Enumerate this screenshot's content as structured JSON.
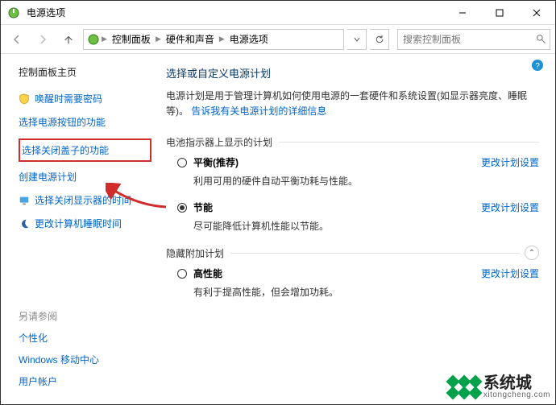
{
  "window": {
    "title": "电源选项"
  },
  "breadcrumb": {
    "items": [
      "控制面板",
      "硬件和声音",
      "电源选项"
    ]
  },
  "search": {
    "placeholder": "搜索控制面板"
  },
  "sidebar": {
    "home": "控制面板主页",
    "links": [
      "唤醒时需要密码",
      "选择电源按钮的功能",
      "选择关闭盖子的功能",
      "创建电源计划",
      "选择关闭显示器的时间",
      "更改计算机睡眠时间"
    ],
    "see_also_title": "另请参阅",
    "see_also": [
      "个性化",
      "Windows 移动中心",
      "用户帐户"
    ]
  },
  "content": {
    "heading": "选择或自定义电源计划",
    "description": "电源计划是用于管理计算机如何使用电源的一套硬件和系统设置(如显示器亮度、睡眠等)。",
    "tell_more": "告诉我有关电源计划的详细信息",
    "section_shown": "电池指示器上显示的计划",
    "section_hidden": "隐藏附加计划",
    "plans": [
      {
        "name": "平衡",
        "rec": " (推荐)",
        "desc": "利用可用的硬件自动平衡功耗与性能。",
        "checked": false,
        "change": "更改计划设置"
      },
      {
        "name": "节能",
        "rec": "",
        "desc": "尽可能降低计算机性能以节能。",
        "checked": true,
        "change": "更改计划设置"
      },
      {
        "name": "高性能",
        "rec": "",
        "desc": "有利于提高性能，但会增加功耗。",
        "checked": false,
        "change": "更改计划设置"
      }
    ]
  },
  "watermark": {
    "brand": "系统城",
    "url": "xitongcheng.com"
  }
}
